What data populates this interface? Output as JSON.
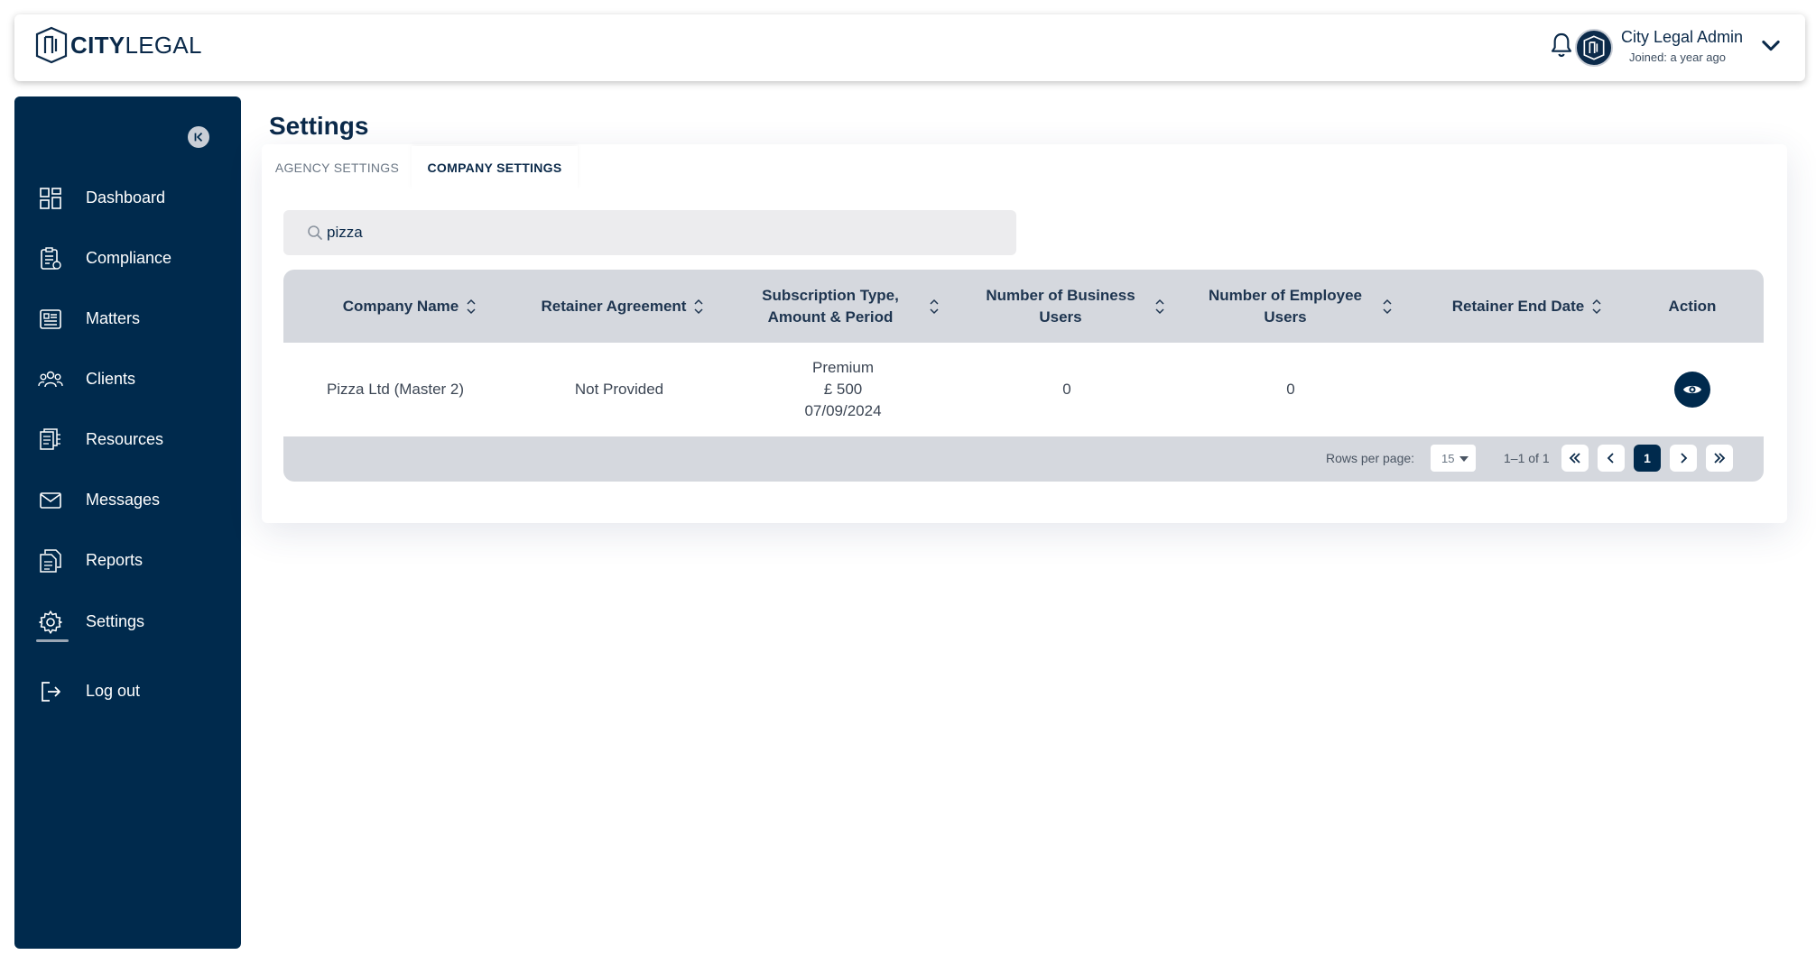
{
  "brand": {
    "strong": "CITY",
    "light": "LEGAL"
  },
  "header": {
    "user_name": "City Legal Admin",
    "user_joined": "Joined: a year ago"
  },
  "sidebar": {
    "items": [
      {
        "label": "Dashboard",
        "icon": "dashboard-icon"
      },
      {
        "label": "Compliance",
        "icon": "compliance-icon"
      },
      {
        "label": "Matters",
        "icon": "matters-icon"
      },
      {
        "label": "Clients",
        "icon": "clients-icon"
      },
      {
        "label": "Resources",
        "icon": "resources-icon"
      },
      {
        "label": "Messages",
        "icon": "mail-icon"
      },
      {
        "label": "Reports",
        "icon": "reports-icon"
      },
      {
        "label": "Settings",
        "icon": "gear-icon",
        "active": true
      },
      {
        "label": "Log out",
        "icon": "logout-icon"
      }
    ]
  },
  "page": {
    "title": "Settings",
    "tabs": [
      {
        "label": "AGENCY SETTINGS"
      },
      {
        "label": "COMPANY SETTINGS",
        "active": true
      }
    ]
  },
  "search": {
    "value": "pizza"
  },
  "table": {
    "columns": [
      "Company Name",
      "Retainer Agreement",
      "Subscription Type, Amount & Period",
      "Number of Business Users",
      "Number of Employee Users",
      "Retainer End Date",
      "Action"
    ],
    "rows": [
      {
        "company_name": "Pizza Ltd (Master 2)",
        "retainer_agreement": "Not Provided",
        "subscription_type": "Premium",
        "subscription_amount": "£ 500",
        "subscription_period": "07/09/2024",
        "business_users": "0",
        "employee_users": "0",
        "retainer_end_date": ""
      }
    ]
  },
  "pagination": {
    "rows_per_page_label": "Rows per page:",
    "rows_per_page": "15",
    "range": "1–1 of 1",
    "current_page": "1"
  },
  "colors": {
    "navy": "#002a4d",
    "header_gray": "#d5d8de",
    "search_bg": "#ececee"
  }
}
